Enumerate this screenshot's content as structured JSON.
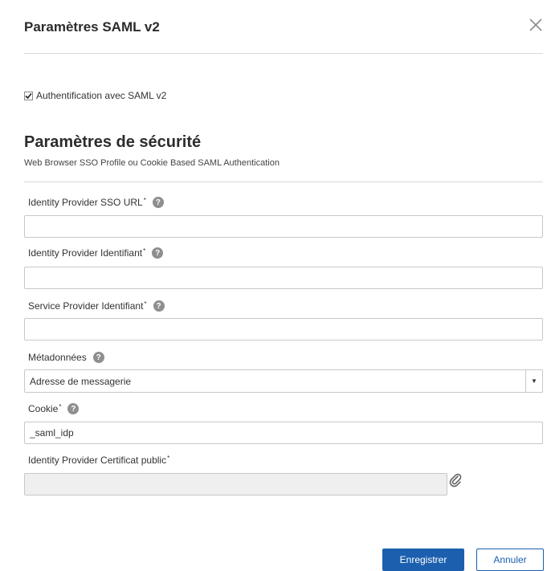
{
  "dialog": {
    "title": "Paramètres SAML v2",
    "close_icon": "close-icon"
  },
  "saml_enabled": {
    "label": "Authentification avec SAML v2",
    "checked": true
  },
  "security": {
    "title": "Paramètres de sécurité",
    "subtitle": "Web Browser SSO Profile ou Cookie Based SAML Authentication"
  },
  "fields": {
    "idp_sso_url": {
      "label": "Identity Provider SSO URL",
      "required_mark": "*",
      "value": ""
    },
    "idp_identifier": {
      "label": "Identity Provider Identifiant",
      "required_mark": "*",
      "value": ""
    },
    "sp_identifier": {
      "label": "Service Provider Identifiant",
      "required_mark": "*",
      "value": ""
    },
    "metadata": {
      "label": "Métadonnées",
      "selected": "Adresse de messagerie"
    },
    "cookie": {
      "label": "Cookie",
      "required_mark": "*",
      "value": "_saml_idp"
    },
    "idp_certificate": {
      "label": "Identity Provider Certificat public",
      "required_mark": "*",
      "value": ""
    }
  },
  "help_icon_glyph": "?",
  "buttons": {
    "save": "Enregistrer",
    "cancel": "Annuler"
  },
  "colors": {
    "primary": "#1b5fae",
    "help_icon": "#8f8f8f",
    "divider": "#d9d9d9"
  }
}
